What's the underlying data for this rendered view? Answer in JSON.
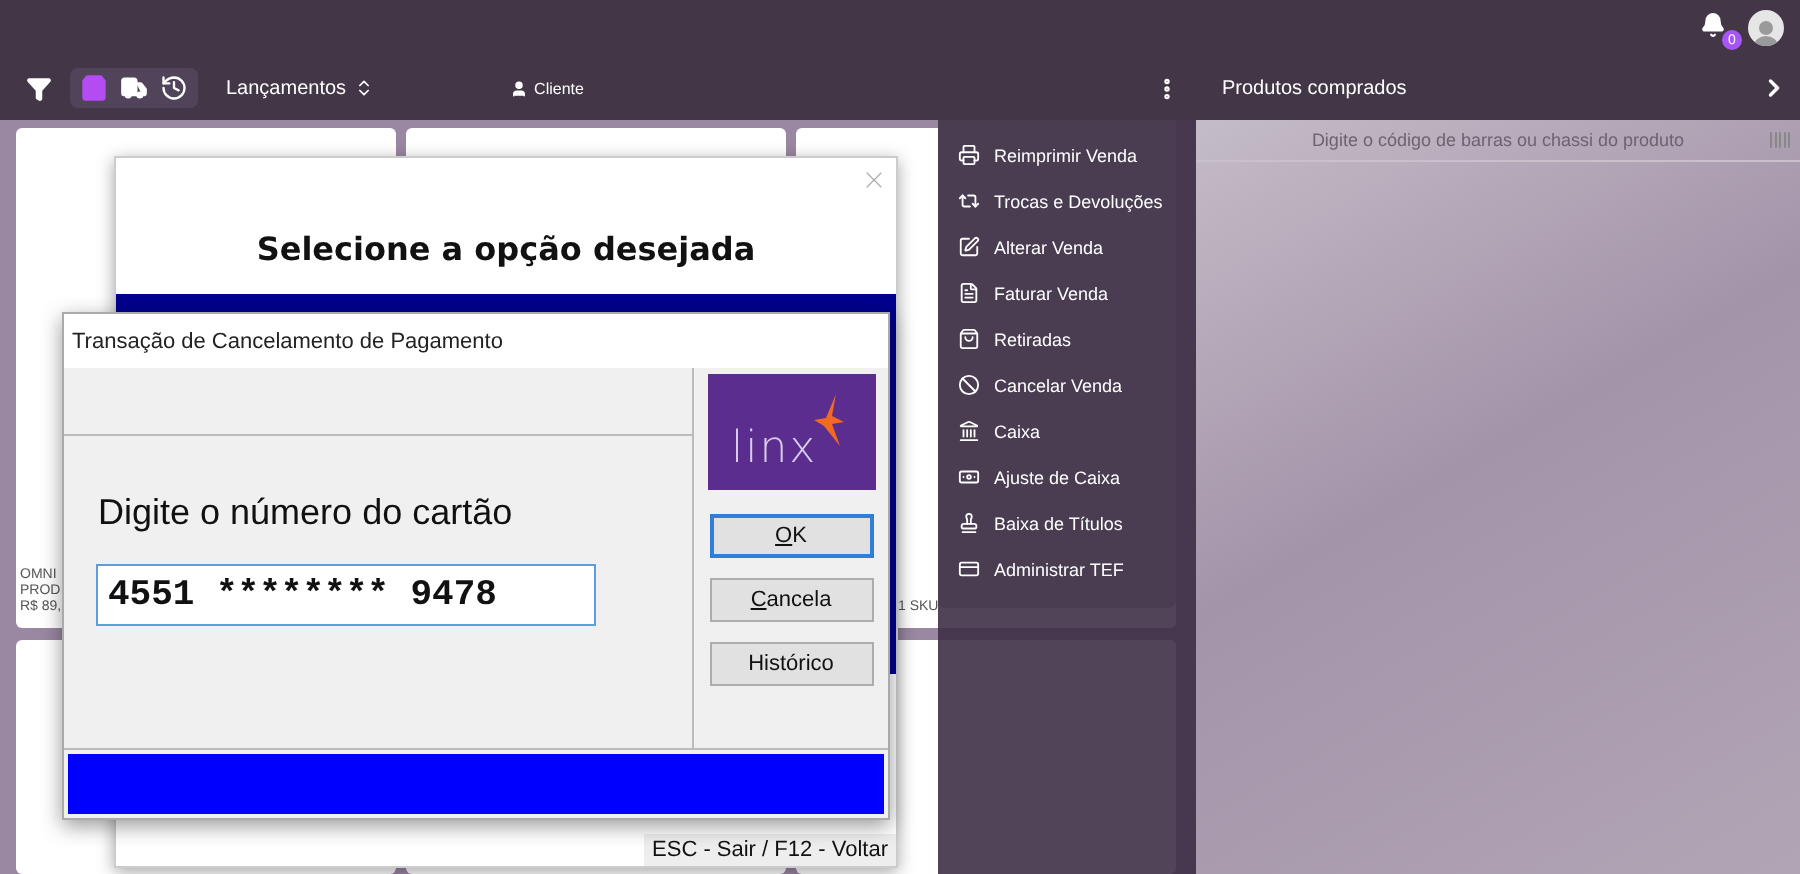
{
  "topbar": {
    "notification_count": "0"
  },
  "toolbar": {
    "view_buttons": [
      {
        "kind": "bag",
        "selected": true
      },
      {
        "kind": "truck",
        "selected": false
      },
      {
        "kind": "history",
        "selected": false
      }
    ],
    "sort_label": "Lançamentos",
    "customer_label": "Cliente"
  },
  "products_panel": {
    "title": "Produtos comprados",
    "search": {
      "placeholder": "Digite o código de barras ou chassi do produto"
    }
  },
  "product_cards": [
    {
      "lines": [
        "OMNI",
        "PROD",
        "R$ 89,"
      ]
    },
    {
      "lines": [
        "1 SKU"
      ]
    }
  ],
  "actions_menu": [
    {
      "label": "Reimprimir Venda"
    },
    {
      "label": "Trocas e Devoluções"
    },
    {
      "label": "Alterar Venda"
    },
    {
      "label": "Faturar Venda"
    },
    {
      "label": "Retiradas"
    },
    {
      "label": "Cancelar Venda"
    },
    {
      "label": "Caixa"
    },
    {
      "label": "Ajuste de Caixa"
    },
    {
      "label": "Baixa de Títulos"
    },
    {
      "label": "Administrar TEF"
    }
  ],
  "option_dialog": {
    "title": "Selecione a opção desejada",
    "footer": "ESC - Sair / F12 - Voltar"
  },
  "payment_dialog": {
    "title": "Transação de Cancelamento de Pagamento",
    "prompt": "Digite o número do cartão",
    "card_number": "4551 ******** 9478",
    "logo_text": "linx",
    "buttons": [
      {
        "label": "OK",
        "underline_first": true,
        "focused": true
      },
      {
        "label": "Cancela",
        "underline_first": true,
        "focused": false
      },
      {
        "label": "Histórico",
        "underline_first": false,
        "focused": false
      }
    ]
  }
}
